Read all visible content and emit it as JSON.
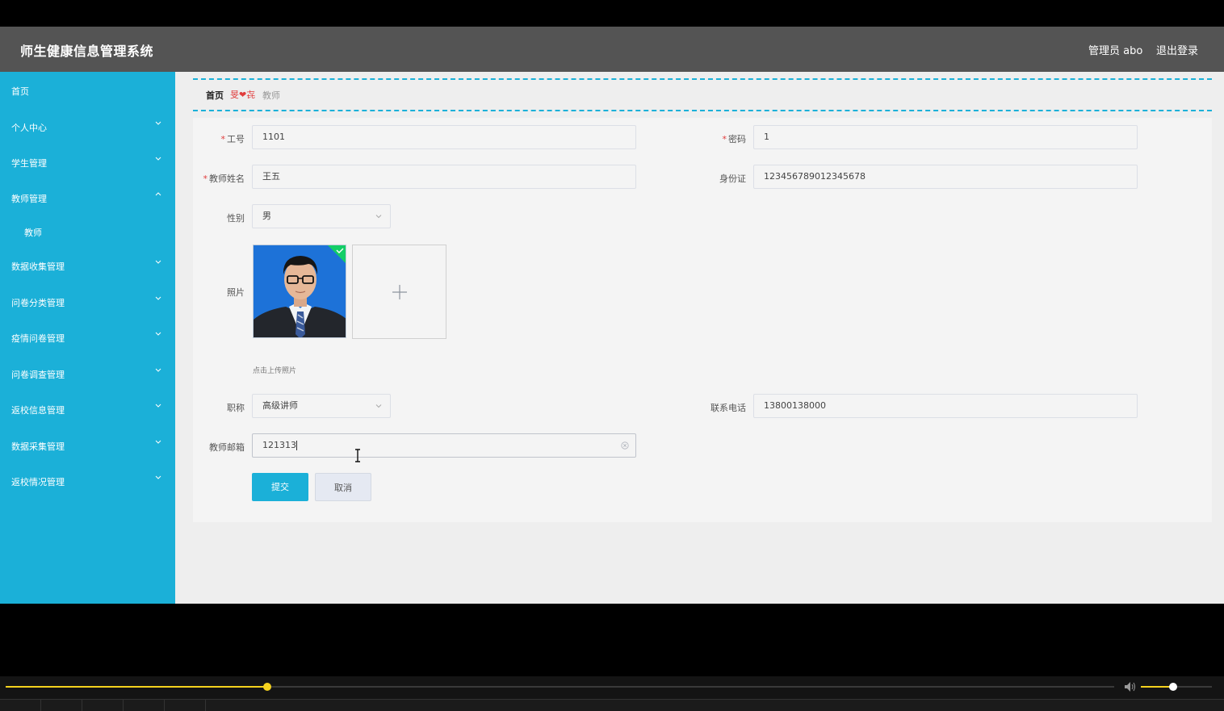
{
  "header": {
    "app_title": "师生健康信息管理系统",
    "user": "管理员 abo",
    "logout": "退出登录"
  },
  "sidebar": {
    "items": [
      {
        "label": "首页"
      },
      {
        "label": "个人中心"
      },
      {
        "label": "学生管理"
      },
      {
        "label": "教师管理"
      },
      {
        "label": "教师"
      },
      {
        "label": "数据收集管理"
      },
      {
        "label": "问卷分类管理"
      },
      {
        "label": "疫情问卷管理"
      },
      {
        "label": "问卷调查管理"
      },
      {
        "label": "返校信息管理"
      },
      {
        "label": "数据采集管理"
      },
      {
        "label": "返校情况管理"
      }
    ]
  },
  "breadcrumb": {
    "home": "首页",
    "separator": "旻❤㐂",
    "current": "教师"
  },
  "form": {
    "job_no": {
      "label": "工号",
      "value": "1101"
    },
    "password": {
      "label": "密码",
      "value": "1"
    },
    "teacher_name": {
      "label": "教师姓名",
      "value": "王五"
    },
    "id_card": {
      "label": "身份证",
      "value": "123456789012345678"
    },
    "gender": {
      "label": "性别",
      "value": "男"
    },
    "photo": {
      "label": "照片",
      "hint": "点击上传照片"
    },
    "title": {
      "label": "职称",
      "value": "高级讲师"
    },
    "phone": {
      "label": "联系电话",
      "value": "13800138000"
    },
    "email": {
      "label": "教师邮箱",
      "value": "121313"
    },
    "required_mark": "*",
    "submit": "提交",
    "cancel": "取消"
  },
  "player": {
    "progress": 0.236,
    "volume": 0.45
  },
  "colors": {
    "sidebar": "#1bb0d8",
    "topbar": "#545454",
    "accent": "#f5d21e",
    "required": "#e03c3c"
  }
}
